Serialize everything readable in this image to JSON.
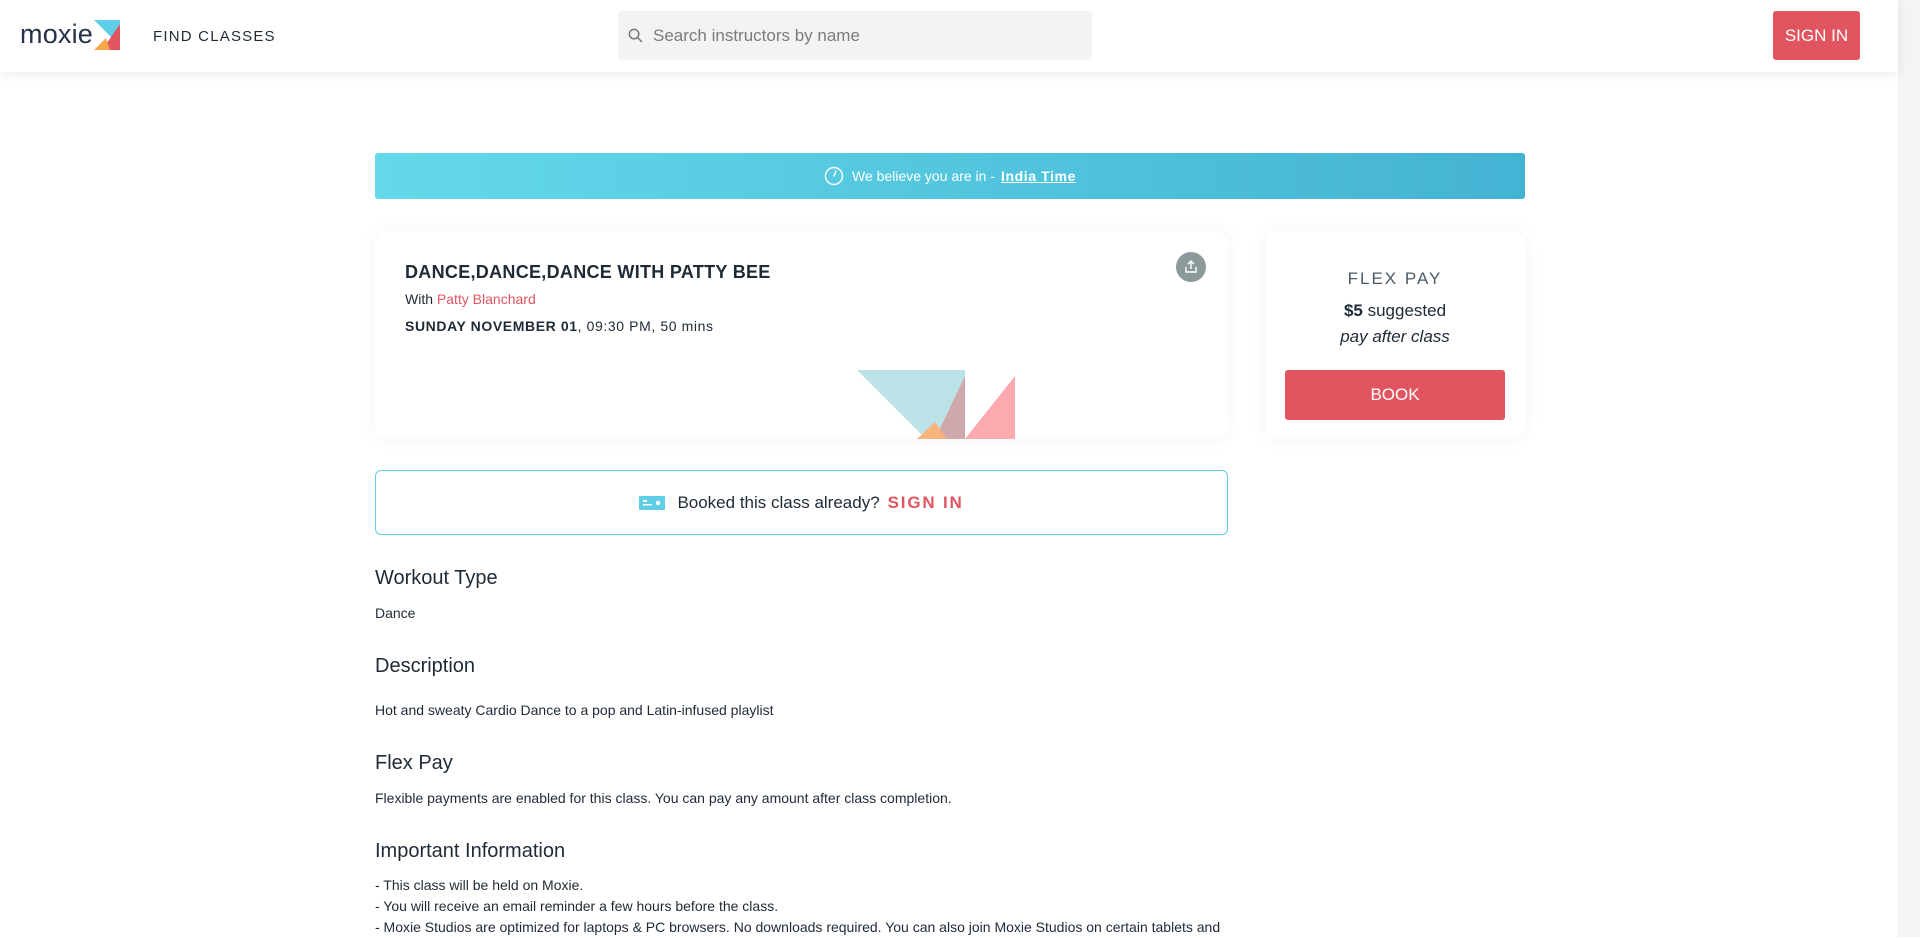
{
  "header": {
    "logo_text": "moxie",
    "nav_find_classes": "FIND CLASSES",
    "search_placeholder": "Search instructors by name",
    "signin_label": "SIGN IN"
  },
  "banner": {
    "text": "We believe you are in -",
    "timezone": "India Time"
  },
  "class_card": {
    "title": "DANCE,DANCE,DANCE WITH PATTY BEE",
    "with_label": "With",
    "instructor": "Patty Blanchard",
    "date": "SUNDAY NOVEMBER 01",
    "time_sep": ",",
    "time": "09:30 PM, 50 mins"
  },
  "pay_card": {
    "title": "FLEX PAY",
    "amount": "$5",
    "amount_suffix": "suggested",
    "after": "pay after class",
    "book_label": "BOOK"
  },
  "booked": {
    "question": "Booked this class already?",
    "signin_label": "SIGN IN"
  },
  "details": {
    "workout_heading": "Workout Type",
    "workout_value": "Dance",
    "description_heading": "Description",
    "description_value": "Hot and sweaty Cardio Dance to a pop and Latin-infused playlist",
    "flexpay_heading": "Flex Pay",
    "flexpay_value": "Flexible payments are enabled for this class. You can pay any amount after class completion.",
    "important_heading": "Important Information",
    "important_lines": [
      "- This class will be held on Moxie.",
      "- You will receive an email reminder a few hours before the class.",
      "- Moxie Studios are optimized for laptops & PC browsers. No downloads required. You can also join Moxie Studios on certain tablets and"
    ]
  },
  "colors": {
    "accent_red": "#e05560",
    "banner_start": "#63d9ea",
    "banner_end": "#44b3d3",
    "border_teal": "#5ecfe6"
  },
  "icons": {
    "search": "search-icon",
    "clock": "clock-icon",
    "share": "share-icon",
    "ticket": "ticket-icon"
  }
}
